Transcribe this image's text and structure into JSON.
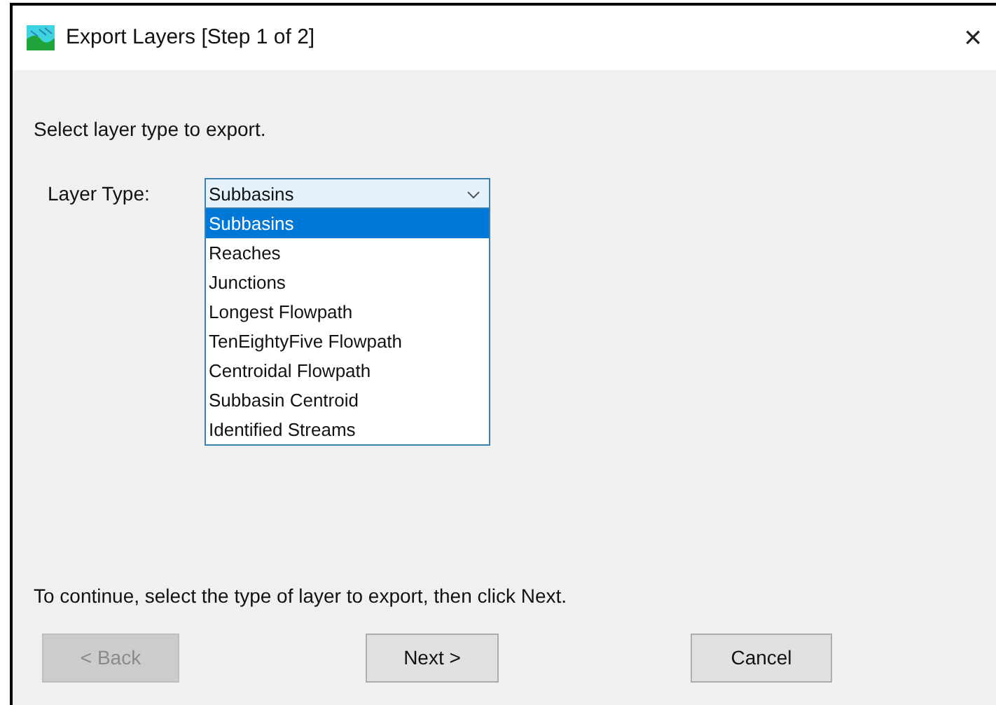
{
  "window": {
    "title": "Export Layers [Step 1 of 2]",
    "close": "×"
  },
  "instruction": "Select layer type to export.",
  "layer_type": {
    "label": "Layer Type:",
    "value": "Subbasins",
    "expanded": true,
    "options": [
      {
        "label": "Subbasins",
        "selected": true
      },
      {
        "label": "Reaches",
        "selected": false
      },
      {
        "label": "Junctions",
        "selected": false
      },
      {
        "label": "Longest Flowpath",
        "selected": false
      },
      {
        "label": "TenEightyFive Flowpath",
        "selected": false
      },
      {
        "label": "Centroidal Flowpath",
        "selected": false
      },
      {
        "label": "Subbasin Centroid",
        "selected": false
      },
      {
        "label": "Identified Streams",
        "selected": false
      }
    ]
  },
  "hint": "To continue, select the type of layer to export, then click Next.",
  "buttons": [
    {
      "label": "< Back",
      "disabled": true
    },
    {
      "label": "Next >",
      "disabled": false
    },
    {
      "label": "Cancel",
      "disabled": false
    }
  ]
}
